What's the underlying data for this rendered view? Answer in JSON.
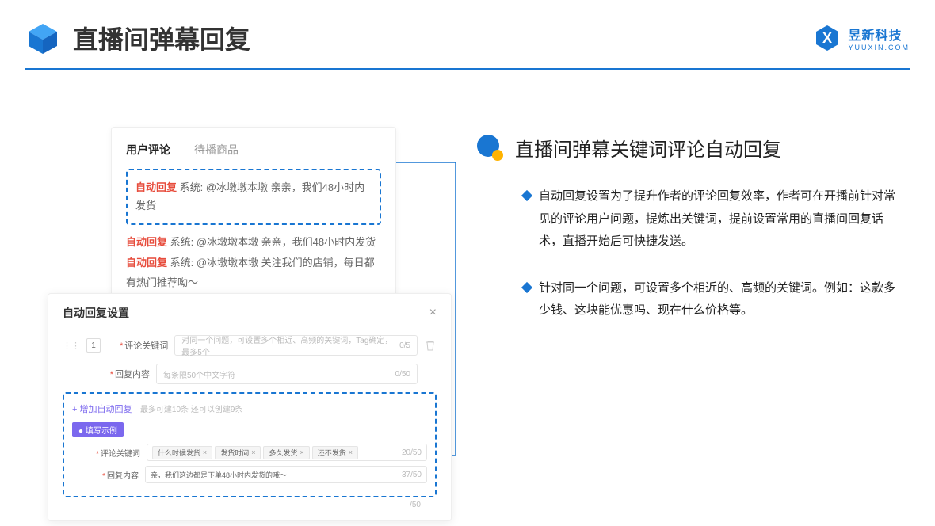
{
  "header": {
    "title": "直播间弹幕回复",
    "brand_name": "昱新科技",
    "brand_sub": "YUUXIN.COM"
  },
  "panel1": {
    "tab_active": "用户评论",
    "tab2": "待播商品",
    "highlighted_comment_prefix": "自动回复",
    "highlighted_comment_mid": " 系统: ",
    "highlighted_comment_text": "@冰墩墩本墩 亲亲，我们48小时内发货",
    "line2_prefix": "自动回复",
    "line2_text": " 系统: @冰墩墩本墩 亲亲，我们48小时内发货",
    "line3_prefix": "自动回复",
    "line3_text": " 系统: @冰墩墩本墩 关注我们的店铺，每日都有热门推荐呦～"
  },
  "panel2": {
    "title": "自动回复设置",
    "row_number": "1",
    "label_keyword": "评论关键词",
    "keyword_placeholder": "对同一个问题，可设置多个相近、高频的关键词，Tag确定，最多5个",
    "keyword_counter": "0/5",
    "label_content": "回复内容",
    "content_placeholder": "每条限50个中文字符",
    "content_counter": "0/50",
    "add_link": "+ 增加自动回复",
    "add_hint": "最多可建10条 还可以创建9条",
    "example_badge": "● 填写示例",
    "ex_label_keyword": "评论关键词",
    "ex_tags": [
      "什么时候发货",
      "发货时间",
      "多久发货",
      "还不发货"
    ],
    "ex_keyword_counter": "20/50",
    "ex_label_content": "回复内容",
    "ex_content_value": "亲，我们这边都是下单48小时内发货的哦～",
    "ex_content_counter": "37/50",
    "outer_counter": "/50"
  },
  "right": {
    "title": "直播间弹幕关键词评论自动回复",
    "bullet1": "自动回复设置为了提升作者的评论回复效率，作者可在开播前针对常见的评论用户问题，提炼出关键词，提前设置常用的直播间回复话术，直播开始后可快捷发送。",
    "bullet2": "针对同一个问题，可设置多个相近的、高频的关键词。例如：这款多少钱、这块能优惠吗、现在什么价格等。"
  }
}
